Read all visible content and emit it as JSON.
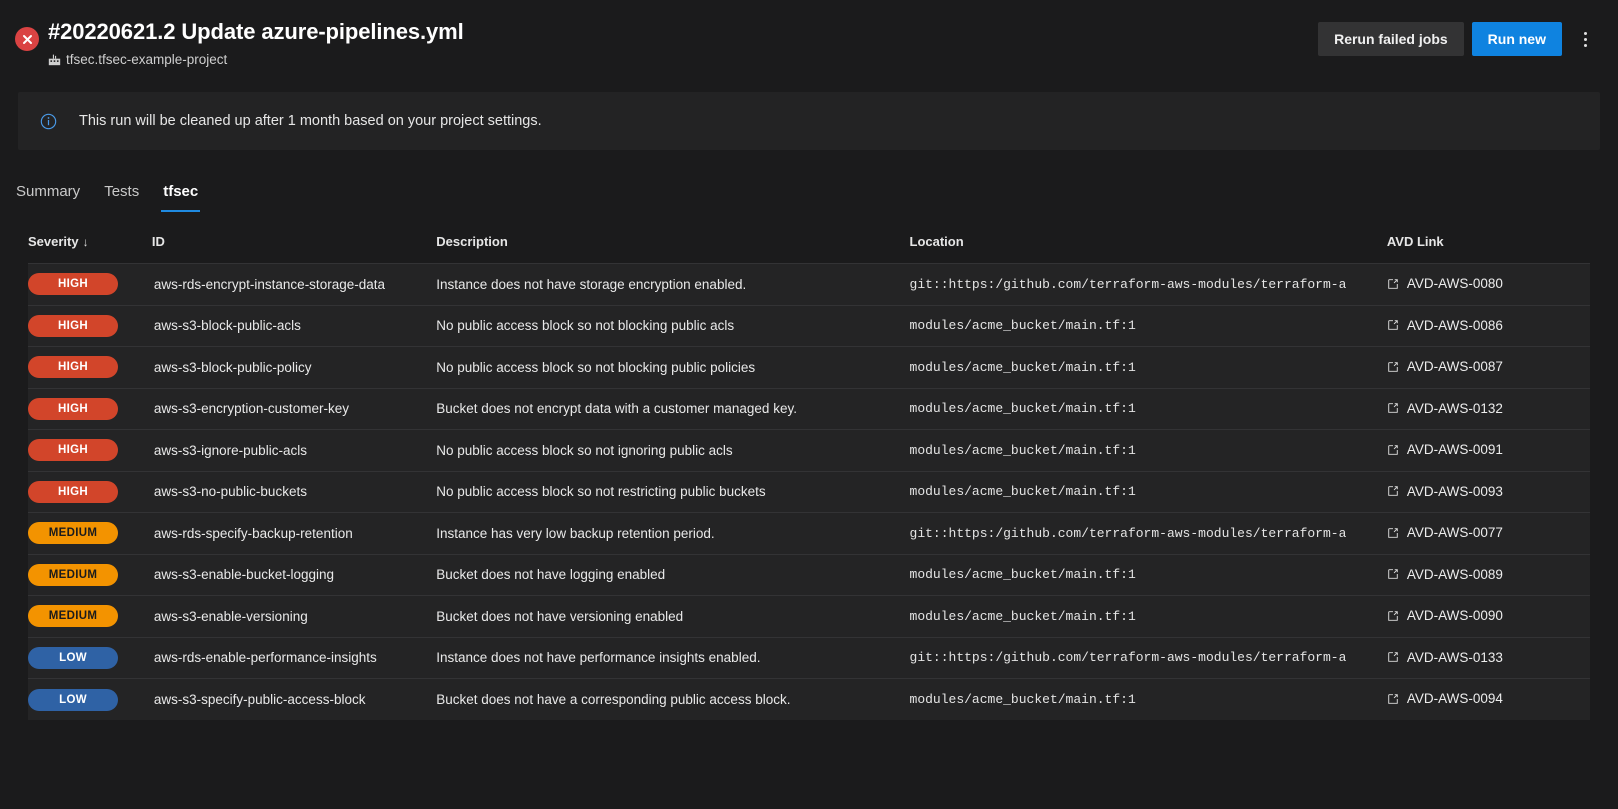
{
  "header": {
    "status_icon": "error-circle-icon",
    "title": "#20220621.2 Update azure-pipelines.yml",
    "repo_icon": "repo-icon",
    "subtitle": "tfsec.tfsec-example-project",
    "rerun_label": "Rerun failed jobs",
    "run_new_label": "Run new",
    "more_actions_icon": "kebab-menu-icon"
  },
  "banner": {
    "icon": "info-icon",
    "text": "This run will be cleaned up after 1 month based on your project settings."
  },
  "tabs": [
    {
      "label": "Summary",
      "active": false
    },
    {
      "label": "Tests",
      "active": false
    },
    {
      "label": "tfsec",
      "active": true
    }
  ],
  "table": {
    "columns": {
      "severity": "Severity",
      "severity_sort": "↓",
      "id": "ID",
      "description": "Description",
      "location": "Location",
      "avd_link": "AVD Link"
    },
    "link_icon": "external-link-icon",
    "rows": [
      {
        "severity": "HIGH",
        "id": "aws-rds-encrypt-instance-storage-data",
        "description": "Instance does not have storage encryption enabled.",
        "location": "git::https:/github.com/terraform-aws-modules/terraform-a",
        "avd": "AVD-AWS-0080"
      },
      {
        "severity": "HIGH",
        "id": "aws-s3-block-public-acls",
        "description": "No public access block so not blocking public acls",
        "location": "modules/acme_bucket/main.tf:1",
        "avd": "AVD-AWS-0086"
      },
      {
        "severity": "HIGH",
        "id": "aws-s3-block-public-policy",
        "description": "No public access block so not blocking public policies",
        "location": "modules/acme_bucket/main.tf:1",
        "avd": "AVD-AWS-0087"
      },
      {
        "severity": "HIGH",
        "id": "aws-s3-encryption-customer-key",
        "description": "Bucket does not encrypt data with a customer managed key.",
        "location": "modules/acme_bucket/main.tf:1",
        "avd": "AVD-AWS-0132"
      },
      {
        "severity": "HIGH",
        "id": "aws-s3-ignore-public-acls",
        "description": "No public access block so not ignoring public acls",
        "location": "modules/acme_bucket/main.tf:1",
        "avd": "AVD-AWS-0091"
      },
      {
        "severity": "HIGH",
        "id": "aws-s3-no-public-buckets",
        "description": "No public access block so not restricting public buckets",
        "location": "modules/acme_bucket/main.tf:1",
        "avd": "AVD-AWS-0093"
      },
      {
        "severity": "MEDIUM",
        "id": "aws-rds-specify-backup-retention",
        "description": "Instance has very low backup retention period.",
        "location": "git::https:/github.com/terraform-aws-modules/terraform-a",
        "avd": "AVD-AWS-0077"
      },
      {
        "severity": "MEDIUM",
        "id": "aws-s3-enable-bucket-logging",
        "description": "Bucket does not have logging enabled",
        "location": "modules/acme_bucket/main.tf:1",
        "avd": "AVD-AWS-0089"
      },
      {
        "severity": "MEDIUM",
        "id": "aws-s3-enable-versioning",
        "description": "Bucket does not have versioning enabled",
        "location": "modules/acme_bucket/main.tf:1",
        "avd": "AVD-AWS-0090"
      },
      {
        "severity": "LOW",
        "id": "aws-rds-enable-performance-insights",
        "description": "Instance does not have performance insights enabled.",
        "location": "git::https:/github.com/terraform-aws-modules/terraform-a",
        "avd": "AVD-AWS-0133"
      },
      {
        "severity": "LOW",
        "id": "aws-s3-specify-public-access-block",
        "description": "Bucket does not have a corresponding public access block.",
        "location": "modules/acme_bucket/main.tf:1",
        "avd": "AVD-AWS-0094"
      }
    ]
  },
  "colors": {
    "high": "#d2452a",
    "medium": "#f39300",
    "low": "#2f62a5",
    "accent": "#0f83e0",
    "error": "#da4343",
    "page_bg": "#1b1b1c",
    "row_bg": "#242425"
  }
}
